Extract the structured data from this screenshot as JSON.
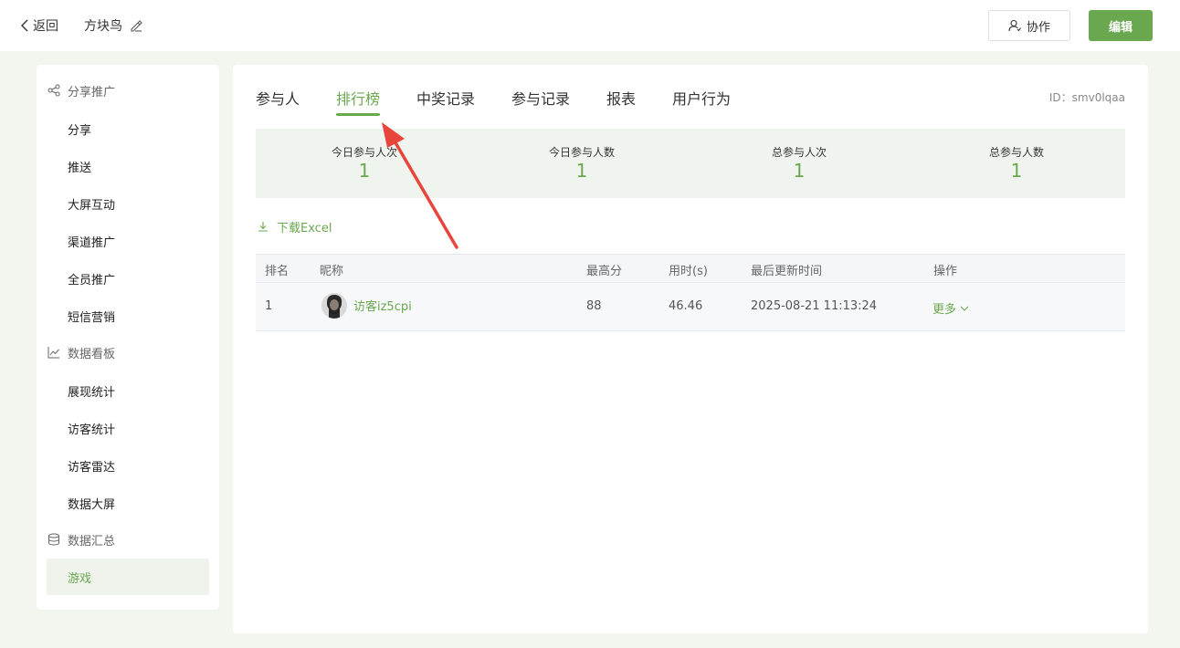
{
  "header": {
    "back_label": "返回",
    "title": "方块鸟",
    "collab_label": "协作",
    "edit_label": "编辑"
  },
  "sidebar": {
    "groups": [
      {
        "label": "分享推广",
        "icon": "share-icon",
        "items": [
          "分享",
          "推送",
          "大屏互动",
          "渠道推广",
          "全员推广",
          "短信营销"
        ]
      },
      {
        "label": "数据看板",
        "icon": "line-chart-icon",
        "items": [
          "展现统计",
          "访客统计",
          "访客雷达",
          "数据大屏"
        ]
      },
      {
        "label": "数据汇总",
        "icon": "database-icon",
        "items": [
          "游戏"
        ]
      }
    ],
    "active_item": "游戏"
  },
  "main": {
    "tabs": [
      "参与人",
      "排行榜",
      "中奖记录",
      "参与记录",
      "报表",
      "用户行为"
    ],
    "active_tab": "排行榜",
    "id_label": "ID：smv0lqaa",
    "stats": [
      {
        "label": "今日参与人次",
        "value": "1"
      },
      {
        "label": "今日参与人数",
        "value": "1"
      },
      {
        "label": "总参与人次",
        "value": "1"
      },
      {
        "label": "总参与人数",
        "value": "1"
      }
    ],
    "download_label": "下载Excel",
    "table": {
      "columns": [
        "排名",
        "昵称",
        "最高分",
        "用时(s)",
        "最后更新时间",
        "操作"
      ],
      "rows": [
        {
          "rank": "1",
          "nickname": "访客iz5cpi",
          "score": "88",
          "time": "46.46",
          "updated": "2025-08-21 11:13:24",
          "action": "更多"
        }
      ]
    }
  },
  "colors": {
    "accent": "#6aa84f",
    "annotation_arrow": "#e8453c"
  }
}
